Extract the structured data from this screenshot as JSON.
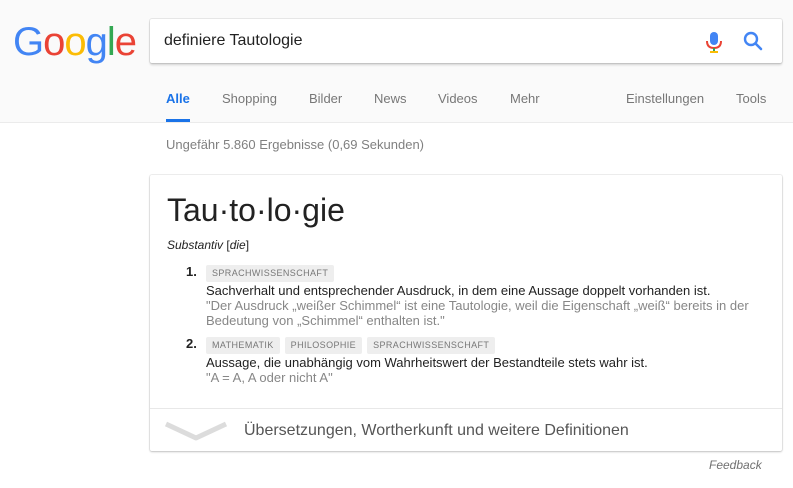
{
  "logo": {
    "letters": [
      "G",
      "o",
      "o",
      "g",
      "l",
      "e"
    ]
  },
  "search": {
    "query": "definiere Tautologie"
  },
  "tabs": {
    "all": "Alle",
    "shopping": "Shopping",
    "images": "Bilder",
    "news": "News",
    "videos": "Videos",
    "more": "Mehr",
    "settings": "Einstellungen",
    "tools": "Tools"
  },
  "results": {
    "stats": "Ungefähr 5.860 Ergebnisse (0,69 Sekunden)"
  },
  "dictionary": {
    "headword": "Tau·to·lo·gie",
    "part_of_speech": "Substantiv",
    "article": "die",
    "senses": [
      {
        "number": "1.",
        "labels": [
          "SPRACHWISSENSCHAFT"
        ],
        "definition": "Sachverhalt und entsprechender Ausdruck, in dem eine Aussage doppelt vorhanden ist.",
        "example": "\"Der Ausdruck „weißer Schimmel“ ist eine Tautologie, weil die Eigenschaft „weiß“ bereits in der Bedeutung von „Schimmel“ enthalten ist.\""
      },
      {
        "number": "2.",
        "labels": [
          "MATHEMATIK",
          "PHILOSOPHIE",
          "SPRACHWISSENSCHAFT"
        ],
        "definition": "Aussage, die unabhängig vom Wahrheitswert der Bestandteile stets wahr ist.",
        "example": "\"A = A, A oder nicht A\""
      }
    ],
    "more_label": "Übersetzungen, Wortherkunft und weitere Definitionen"
  },
  "feedback": "Feedback",
  "colors": {
    "accent": "#1a73e8",
    "google_blue": "#4285F4",
    "google_red": "#EA4335",
    "google_yellow": "#FBBC05",
    "google_green": "#34A853"
  }
}
